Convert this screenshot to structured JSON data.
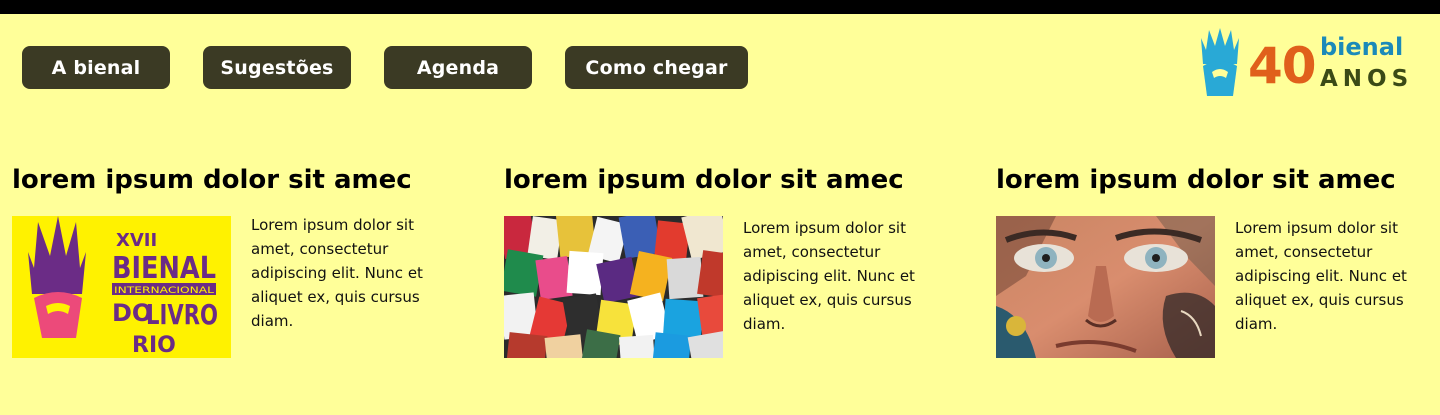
{
  "nav": {
    "items": [
      {
        "label": "A bienal"
      },
      {
        "label": "Sugestões"
      },
      {
        "label": "Agenda"
      },
      {
        "label": "Como chegar"
      }
    ]
  },
  "logo": {
    "number": "40",
    "word": "bienal",
    "subword": "ANOS",
    "colors": {
      "number": "#e0601b",
      "word": "#1b8ab9",
      "subword": "#3b4a16",
      "crown": "#29a9d6"
    }
  },
  "cards": [
    {
      "title": "lorem ipsum dolor sit amec",
      "image": {
        "kind": "bienal-poster",
        "lines": [
          "XVII",
          "BIENAL",
          "INTERNACIONAL",
          "DO",
          "LIVRO",
          "RIO"
        ]
      },
      "text": "Lorem ipsum dolor sit amet, consectetur adipiscing elit. Nunc et aliquet ex, quis cursus diam."
    },
    {
      "title": "lorem ipsum dolor sit amec",
      "image": {
        "kind": "books-photo"
      },
      "text": "Lorem ipsum dolor sit amet, consectetur adipiscing elit. Nunc et aliquet ex, quis cursus diam."
    },
    {
      "title": "lorem ipsum dolor sit amec",
      "image": {
        "kind": "face-mural-photo"
      },
      "text": "Lorem ipsum dolor sit amet, consectetur adipiscing elit. Nunc et aliquet ex, quis cursus diam."
    }
  ],
  "colors": {
    "background": "#ffff99",
    "nav_button": "#3b3a24",
    "top_bar": "#000000"
  }
}
